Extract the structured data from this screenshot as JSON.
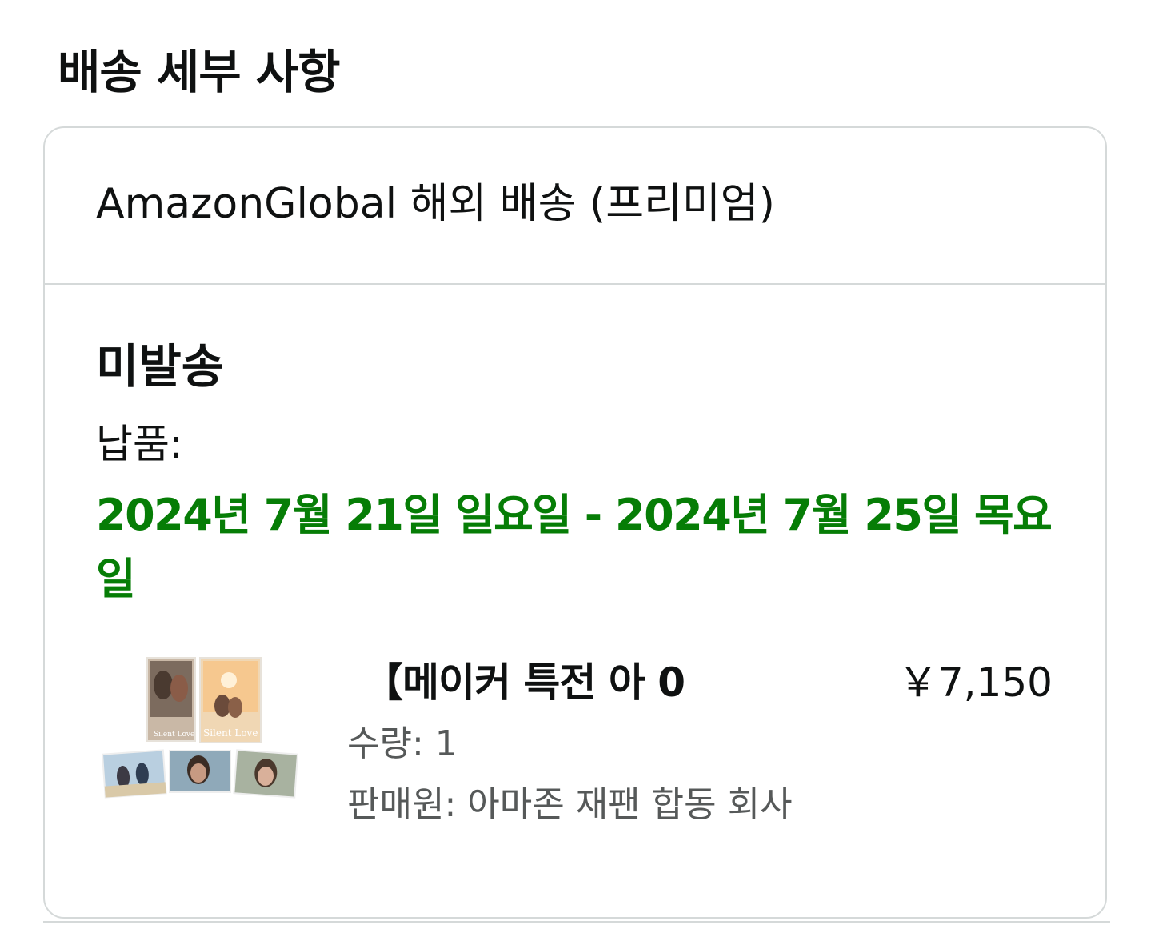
{
  "section": {
    "title": "배송 세부 사항"
  },
  "shipment": {
    "method": "AmazonGlobal 해외 배송 (프리미엄)",
    "status": "미발송",
    "delivery_label": "납품:",
    "delivery_date": "2024년 7월 21일 일요일 - 2024년 7월 25일 목요일",
    "accent_color": "#067d06"
  },
  "item": {
    "title": "【메이커 특전 아 0",
    "price": "￥7,150",
    "quantity_label": "수량:",
    "quantity": "1",
    "seller_label": "판매원:",
    "seller": "아마존 재팬 합동 회사",
    "image_caption": "Silent Love"
  }
}
